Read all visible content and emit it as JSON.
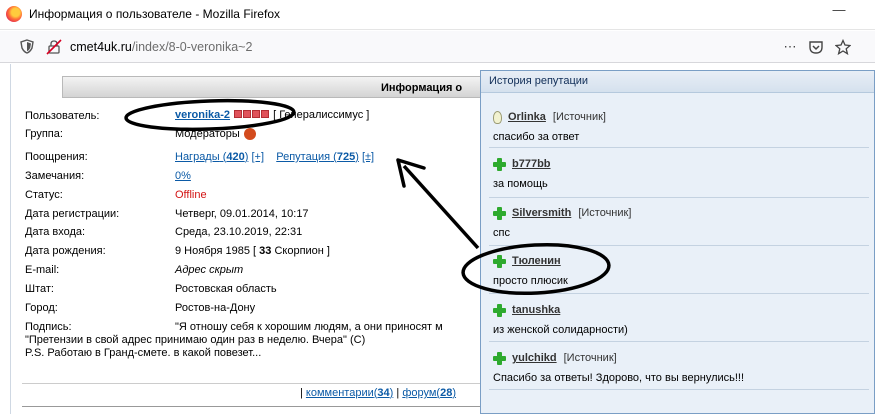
{
  "window": {
    "title": "Информация о пользователе - Mozilla Firefox",
    "min_symbol": "—"
  },
  "navbar": {
    "url_host": "cmet4uk.ru",
    "url_path": "/index/8-0-veronika~2"
  },
  "header": {
    "title": "Информация о"
  },
  "profile": {
    "username_label": "Пользователь:",
    "username": "veronika-2",
    "rank": "[ Генералиссимус ]",
    "group_label": "Группа:",
    "group": "Модераторы",
    "rewards_label": "Поощрения:",
    "rewards_link": "Награды",
    "rewards_count": "420",
    "rewards_add": "[+]",
    "reputation_link": "Репутация",
    "reputation_count": "725",
    "reputation_add": "[±]",
    "remarks_label": "Замечания:",
    "remarks": "0%",
    "status_label": "Статус:",
    "status": "Offline",
    "reg_label": "Дата регистрации:",
    "reg_date": "Четверг, 09.01.2014, 10:17",
    "login_label": "Дата входа:",
    "login_date": "Среда, 23.10.2019, 22:31",
    "birth_label": "Дата рождения:",
    "birth_date": "9 Ноября 1985 [",
    "birth_age": "33",
    "birth_sign": "Скорпион ]",
    "email_label": "E-mail:",
    "email": "Адрес скрыт",
    "state_label": "Штат:",
    "state": "Ростовская область",
    "city_label": "Город:",
    "city": "Ростов-на-Дону",
    "signature_label": "Подпись:",
    "signature_line1": "\"Я отношу себя к хорошим людям, а они приносят м",
    "signature_line2": "\"Претензии в свой адрес принимаю один раз в неделю. Вчера\" (С)",
    "signature_line3": "P.S. Работаю в Гранд-смете. в какой повезет..."
  },
  "footer": {
    "sep1": "|",
    "comments_label": "комментарии",
    "comments_count": "34",
    "sep2": "|",
    "forum_label": "форум",
    "forum_count": "28"
  },
  "reputation_panel": {
    "title": "История репутации",
    "source_label": "[Источник]",
    "items": [
      {
        "user": "Orlinka",
        "message": "спасибо за ответ",
        "icon": "bulb-icon"
      },
      {
        "user": "b777bb",
        "message": "за помощь",
        "icon": "plus-icon"
      },
      {
        "user": "Silversmith",
        "message": "спс",
        "icon": "plus-icon"
      },
      {
        "user": "Тюленин",
        "message": "просто плюсик",
        "icon": "plus-icon"
      },
      {
        "user": "tanushka",
        "message": "из женской солидарности)",
        "icon": "plus-icon"
      },
      {
        "user": "yulchikd",
        "message": "Спасибо за ответы! Здорово, что вы вернулись!!!",
        "icon": "plus-icon"
      }
    ]
  },
  "colors": {
    "link": "#0b5aa6",
    "offline": "#d31313",
    "panel_bg": "#e9f0f8",
    "plus": "#2eaa2e"
  }
}
